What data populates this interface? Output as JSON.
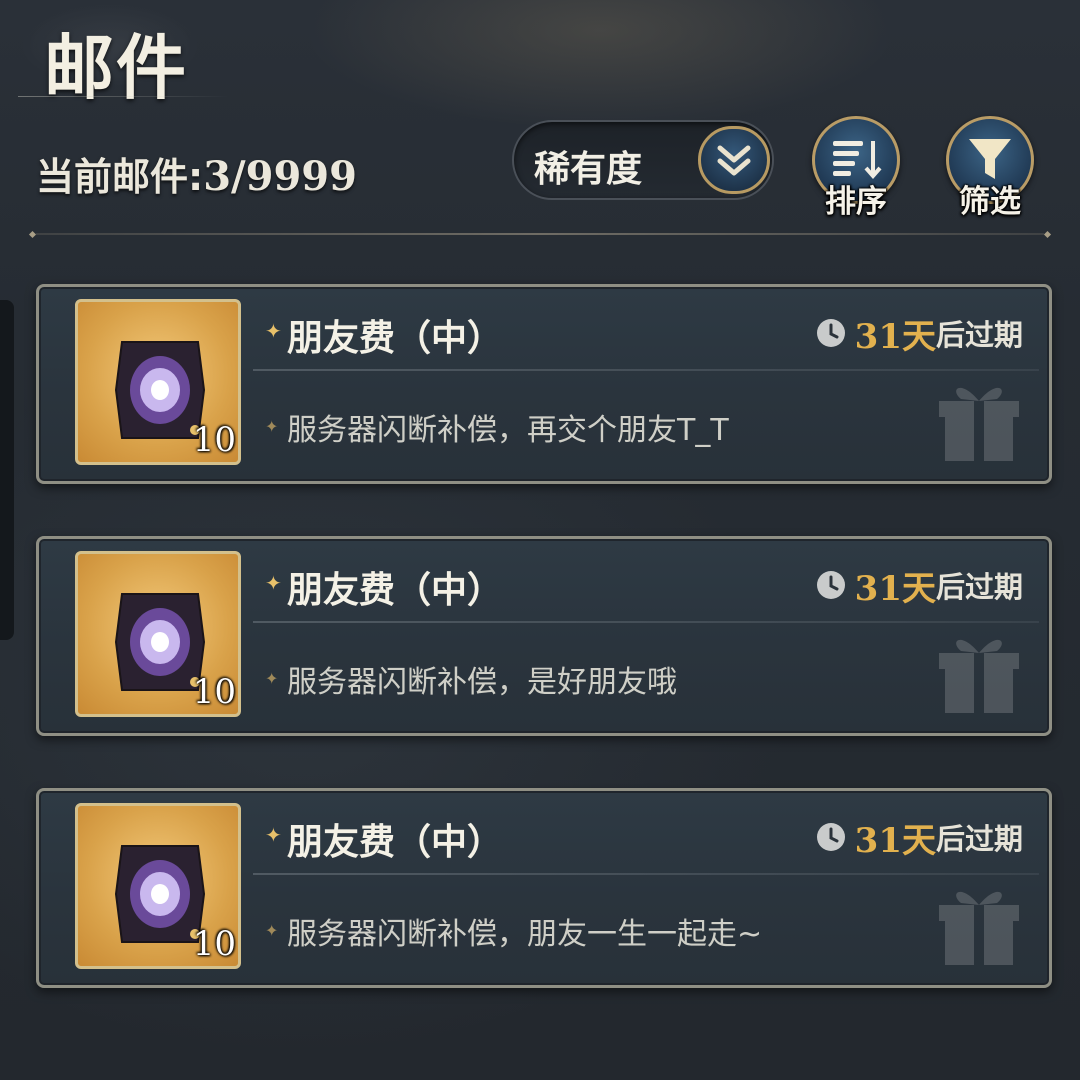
{
  "header": {
    "title": "邮件",
    "mail_count_label": "当前邮件:",
    "mail_count_value": "3/9999"
  },
  "toolbar": {
    "sort_select_value": "稀有度",
    "sort_button_label": "排序",
    "filter_button_label": "筛选"
  },
  "colors": {
    "accent_gold": "#e2b14e",
    "button_blue": "#2e5070",
    "card_border": "#8f8f84"
  },
  "mails": [
    {
      "subject": "朋友费（中）",
      "expiry_days": "31天",
      "expiry_suffix": "后过期",
      "body": "服务器闪断补偿，再交个朋友T_T",
      "item_icon": "ticket-card-icon",
      "item_quantity": "10"
    },
    {
      "subject": "朋友费（中）",
      "expiry_days": "31天",
      "expiry_suffix": "后过期",
      "body": "服务器闪断补偿，是好朋友哦",
      "item_icon": "ticket-card-icon",
      "item_quantity": "10"
    },
    {
      "subject": "朋友费（中）",
      "expiry_days": "31天",
      "expiry_suffix": "后过期",
      "body": "服务器闪断补偿，朋友一生一起走~",
      "item_icon": "ticket-card-icon",
      "item_quantity": "10"
    }
  ]
}
